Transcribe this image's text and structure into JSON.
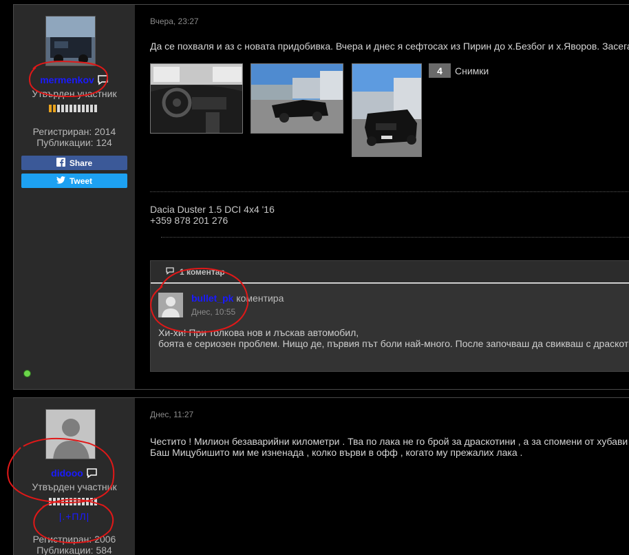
{
  "post1": {
    "author": {
      "username": "mermenkov",
      "rank": "Утвърден участник",
      "registered": "Регистриран: 2014",
      "posts": "Публикации: 124",
      "share_label": "Share",
      "tweet_label": "Tweet"
    },
    "time": "Вчера, 23:27",
    "text": "Да се похваля и аз с новата придобивка. Вчера и днес я сефтосах из Пирин до х.Безбог и х.Яворов. Засега",
    "photos_count": "4",
    "photos_label": "Снимки",
    "signature": [
      "Dacia Duster 1.5 DCI 4x4 '16",
      "+359 878 201 276"
    ],
    "comments": {
      "header": "1 коментар",
      "items": [
        {
          "user": "bullet_pk",
          "action": "коментира",
          "date": "Днес, 10:55",
          "lines": [
            "Хи-хи! При толкова нов и лъскав автомобил,",
            "боята е сериозен проблем. Нищо де, първия път боли най-много. После започваш да свикваш с драскотини"
          ]
        }
      ]
    }
  },
  "post2": {
    "author": {
      "username": "didooo",
      "rank": "Утвърден участник",
      "note": "|.+ПЛ|",
      "registered": "Регистриран: 2006",
      "posts": "Публикации: 584"
    },
    "time": "Днес, 11:27",
    "lines": [
      "Честито ! Милион безаварийни километри . Тва по лака не го брой за драскотини , а за спомени от хубави места",
      "Баш Мицубишито ми ме изненада , колко върви в офф , когато му прежалих лака ."
    ]
  },
  "colors": {
    "username": "#1a1aff",
    "reputation_on": "#e8a21d",
    "online": "#6bd64a",
    "facebook": "#3b5998",
    "twitter": "#1da1f2",
    "annotation": "#e01818"
  }
}
